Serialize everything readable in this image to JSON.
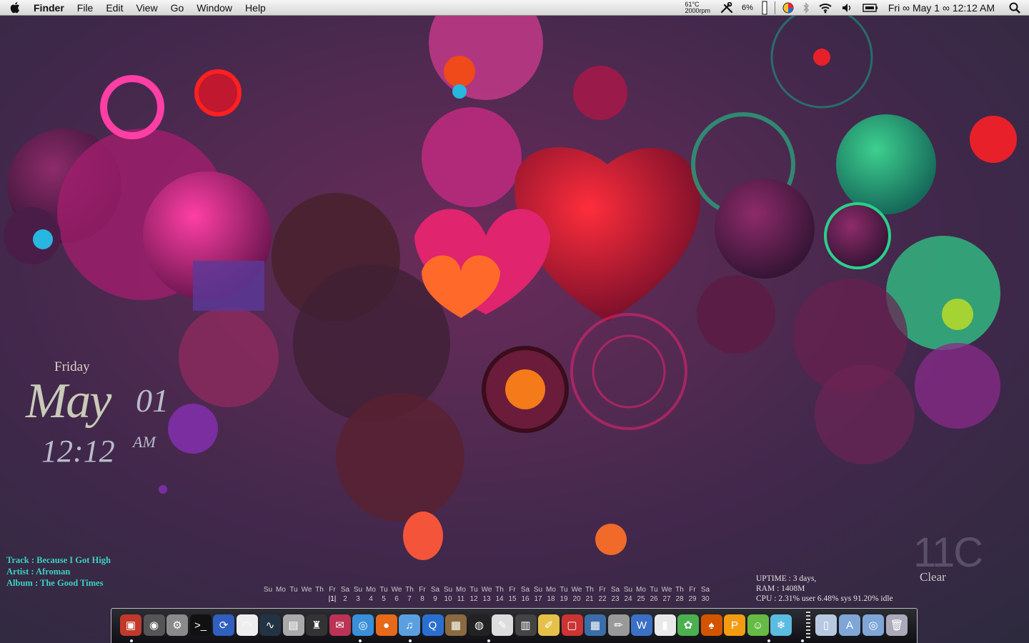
{
  "menubar": {
    "app_name": "Finder",
    "menus": [
      "File",
      "Edit",
      "View",
      "Go",
      "Window",
      "Help"
    ],
    "temperature": "61°C",
    "fan_speed": "2000rpm",
    "cpu_percent": "6%",
    "clock": "Fri ∞ May 1 ∞ 12:12 AM",
    "icons": [
      "apple-icon",
      "tools-icon",
      "battery-gauge-icon",
      "color-picker-icon",
      "bluetooth-icon",
      "wifi-icon",
      "volume-icon",
      "display-icon",
      "spotlight-icon"
    ]
  },
  "date_widget": {
    "day": "Friday",
    "month": "May",
    "day_number": "01",
    "time": "12:12",
    "ampm": "AM"
  },
  "music": {
    "track": "Track : Because I Got High",
    "artist": "Artist : Afroman",
    "album": "Album : The Good Times"
  },
  "weather": {
    "temp": "11C",
    "condition": "Clear"
  },
  "system": {
    "uptime": "UPTIME : 3 days,",
    "ram": "RAM : 1408M",
    "cpu": "CPU : 2.31% user  6.48% sys  91.20% idle"
  },
  "calendar": {
    "weekdays": [
      "Su",
      "Mo",
      "Tu",
      "We",
      "Th",
      "Fr",
      "Sa",
      "Su",
      "Mo",
      "Tu",
      "We",
      "Th",
      "Fr",
      "Sa",
      "Su",
      "Mo",
      "Tu",
      "We",
      "Th",
      "Fr",
      "Sa",
      "Su",
      "Mo",
      "Tu",
      "We",
      "Th",
      "Fr",
      "Sa",
      "Su",
      "Mo",
      "Tu",
      "We",
      "Th",
      "Fr",
      "Sa"
    ],
    "days": [
      "",
      "",
      "",
      "",
      "",
      "|1|",
      "2",
      "3",
      "4",
      "5",
      "6",
      "7",
      "8",
      "9",
      "10",
      "11",
      "12",
      "13",
      "14",
      "15",
      "16",
      "17",
      "18",
      "19",
      "20",
      "21",
      "22",
      "23",
      "24",
      "25",
      "26",
      "27",
      "28",
      "29",
      "30"
    ]
  },
  "dock": {
    "apps": [
      {
        "icon": "photo-booth-icon",
        "color": "#c0392b",
        "glyph": "▣"
      },
      {
        "icon": "dashboard-icon",
        "color": "#555",
        "glyph": "◉"
      },
      {
        "icon": "system-preferences-icon",
        "color": "#8a8a8a",
        "glyph": "⚙"
      },
      {
        "icon": "terminal-icon",
        "color": "#111",
        "glyph": ">_"
      },
      {
        "icon": "sync-icon",
        "color": "#2f5fbf",
        "glyph": "⟳"
      },
      {
        "icon": "airport-icon",
        "color": "#eee",
        "glyph": "◠"
      },
      {
        "icon": "activity-monitor-icon",
        "color": "#234",
        "glyph": "∿"
      },
      {
        "icon": "hard-drive-icon",
        "color": "#aaa",
        "glyph": "▤"
      },
      {
        "icon": "automator-icon",
        "color": "#333",
        "glyph": "♜"
      },
      {
        "icon": "stamp-icon",
        "color": "#b35",
        "glyph": "✉"
      },
      {
        "icon": "safari-icon",
        "color": "#3a8fd9",
        "glyph": "◎"
      },
      {
        "icon": "firefox-icon",
        "color": "#e66a1a",
        "glyph": "●"
      },
      {
        "icon": "itunes-icon",
        "color": "#5aa0e0",
        "glyph": "♫"
      },
      {
        "icon": "quicktime-icon",
        "color": "#2a6fd0",
        "glyph": "Q"
      },
      {
        "icon": "iphoto-icon",
        "color": "#8a6a40",
        "glyph": "▦"
      },
      {
        "icon": "camera-icon",
        "color": "#222",
        "glyph": "◍"
      },
      {
        "icon": "preview-icon",
        "color": "#ddd",
        "glyph": "✎"
      },
      {
        "icon": "film-icon",
        "color": "#444",
        "glyph": "▥"
      },
      {
        "icon": "textedit-icon",
        "color": "#e6c14a",
        "glyph": "✐"
      },
      {
        "icon": "remote-desktop-icon",
        "color": "#c33",
        "glyph": "▢"
      },
      {
        "icon": "grid-app-icon",
        "color": "#3b6ea8",
        "glyph": "▦"
      },
      {
        "icon": "pencil-app-icon",
        "color": "#999",
        "glyph": "✏"
      },
      {
        "icon": "word-icon",
        "color": "#3b70c4",
        "glyph": "W"
      },
      {
        "icon": "chart-app-icon",
        "color": "#e9e9e9",
        "glyph": "▮"
      },
      {
        "icon": "frog-icon",
        "color": "#4caf50",
        "glyph": "✿"
      },
      {
        "icon": "mushroom-icon",
        "color": "#d35400",
        "glyph": "♠"
      },
      {
        "icon": "pages-icon",
        "color": "#f39c12",
        "glyph": "P"
      },
      {
        "icon": "cartoon-icon",
        "color": "#6b4",
        "glyph": "☺"
      },
      {
        "icon": "snowflake-icon",
        "color": "#5bbbe0",
        "glyph": "❄"
      }
    ],
    "stack_items": [
      {
        "icon": "document-icon",
        "color": "#b8c8e0",
        "glyph": "▯"
      },
      {
        "icon": "applications-folder-icon",
        "color": "#7fa6d6",
        "glyph": "A"
      },
      {
        "icon": "documents-folder-icon",
        "color": "#7fa6d6",
        "glyph": "◎"
      },
      {
        "icon": "trash-icon",
        "color": "#aab",
        "glyph": "🗑"
      }
    ]
  }
}
